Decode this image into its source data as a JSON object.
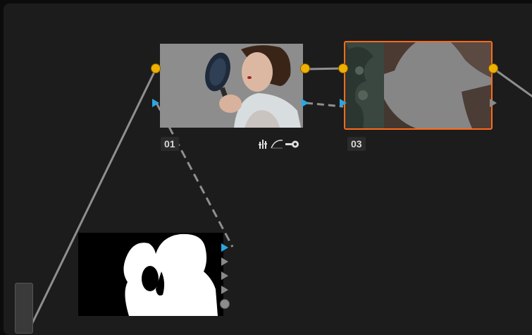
{
  "nodes": [
    {
      "id": "node-01",
      "label": "01",
      "tools": [
        "bars-icon",
        "curve-icon",
        "key-icon"
      ]
    },
    {
      "id": "node-03",
      "label": "03",
      "selected": true,
      "accent": "#ff6a1a"
    },
    {
      "id": "matte-node",
      "label": ""
    }
  ],
  "colors": {
    "rgb_connector": "#f0b000",
    "key_connector": "#2aa7e0",
    "canvas_bg": "#1c1c1c"
  }
}
